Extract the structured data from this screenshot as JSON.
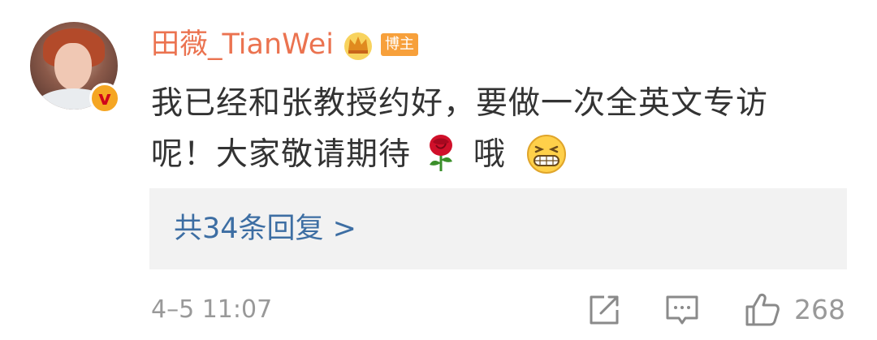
{
  "comment": {
    "username": "田薇_TianWei",
    "badge_label": "博主",
    "text_line1": "我已经和张教授约好，要做一次全英文专访",
    "text_line2_before_emoji": "呢！大家敬请期待",
    "text_line2_after_rose": "哦",
    "icons": [
      "verified-v-icon",
      "crown-icon",
      "rose-icon",
      "grin-icon"
    ]
  },
  "replies": {
    "link_text": "共34条回复 >"
  },
  "footer": {
    "time": "4–5 11:07",
    "like_count": "268",
    "icons": [
      "share-icon",
      "comment-icon",
      "like-icon"
    ]
  },
  "colors": {
    "username": "#eb7350",
    "reply_link": "#3d6ea3",
    "muted": "#999999",
    "badge": "#f7a03b"
  }
}
